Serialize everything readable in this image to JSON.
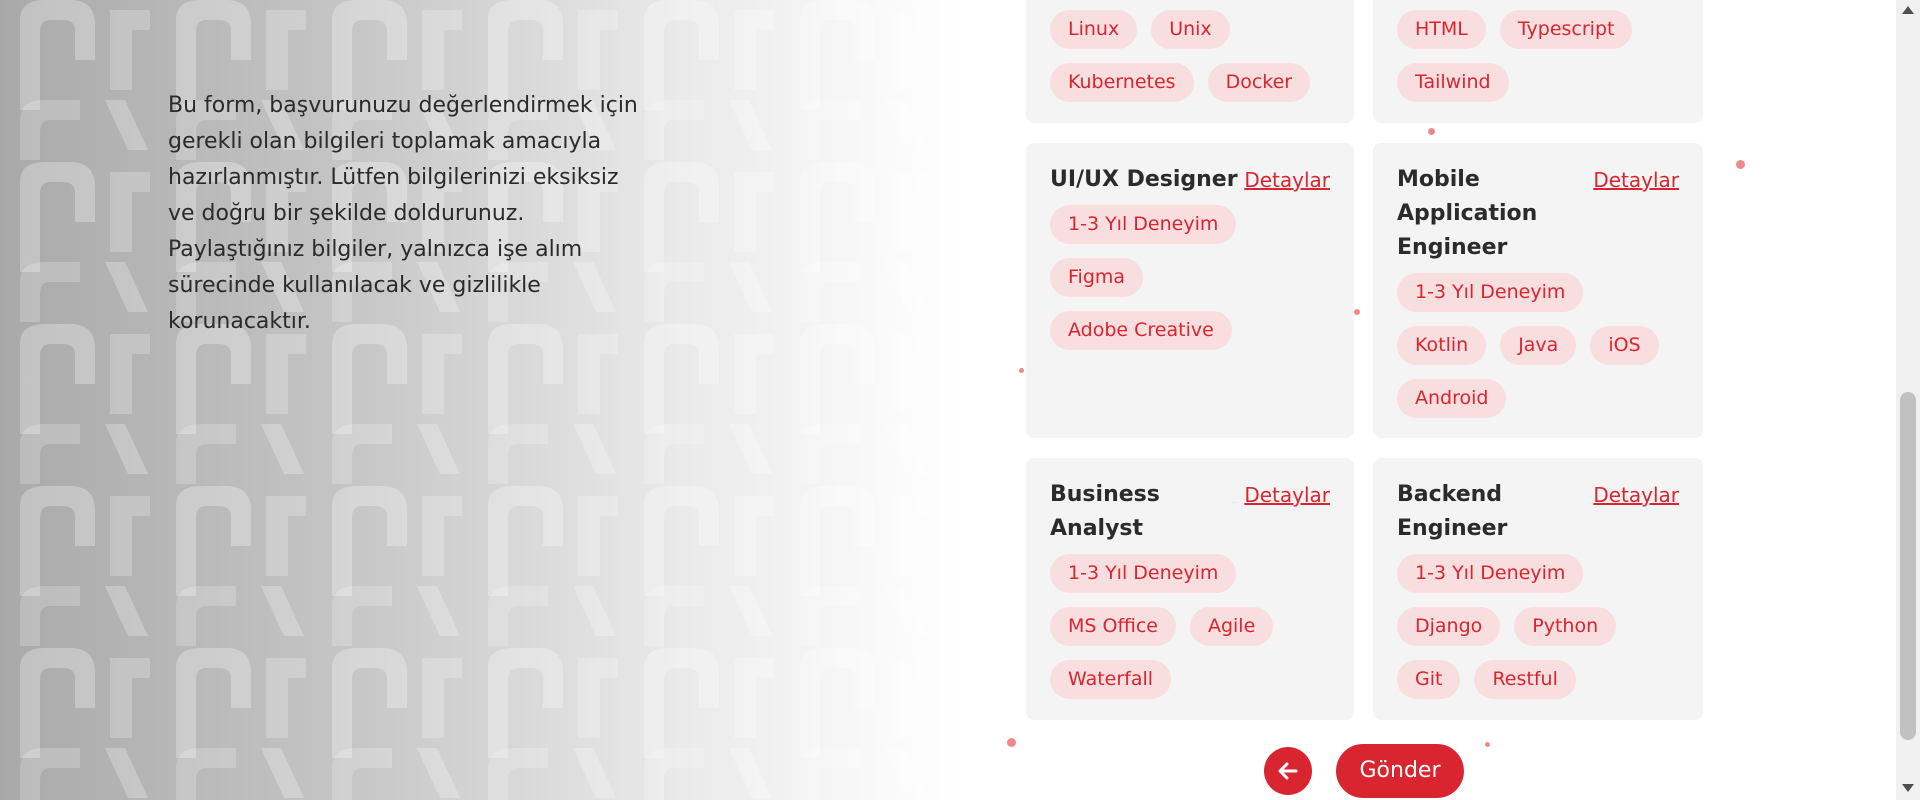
{
  "intro": {
    "text": "Bu form, başvurunuzu değerlendirmek için gerekli olan bilgileri toplamak amacıyla hazırlanmıştır. Lütfen bilgilerinizi eksiksiz ve doğru bir şekilde doldurunuz. Paylaştığınız bilgiler, yalnızca işe alım sürecinde kullanılacak ve gizlilikle korunacaktır."
  },
  "cards": {
    "top_left": {
      "tags": [
        "Linux",
        "Unix",
        "Kubernetes",
        "Docker"
      ]
    },
    "top_right": {
      "tags": [
        "HTML",
        "Typescript",
        "Tailwind"
      ]
    },
    "uiux": {
      "title": "UI/UX Designer",
      "link": "Detaylar",
      "tags": [
        "1-3 Yıl Deneyim",
        "Figma",
        "Adobe Creative"
      ]
    },
    "mobile": {
      "title": "Mobile Application Engineer",
      "link": "Detaylar",
      "tags": [
        "1-3 Yıl Deneyim",
        "Kotlin",
        "Java",
        "iOS",
        "Android"
      ]
    },
    "business": {
      "title": "Business Analyst",
      "link": "Detaylar",
      "tags": [
        "1-3 Yıl Deneyim",
        "MS Office",
        "Agile",
        "Waterfall"
      ]
    },
    "backend": {
      "title": "Backend Engineer",
      "link": "Detaylar",
      "tags": [
        "1-3 Yıl Deneyim",
        "Django",
        "Python",
        "Git",
        "Restful"
      ]
    }
  },
  "buttons": {
    "back_icon": "arrow-left-icon",
    "submit_label": "Gönder"
  },
  "colors": {
    "accent": "#d9252f",
    "tag_bg": "#f8dede",
    "card_bg": "#f4f4f4"
  }
}
